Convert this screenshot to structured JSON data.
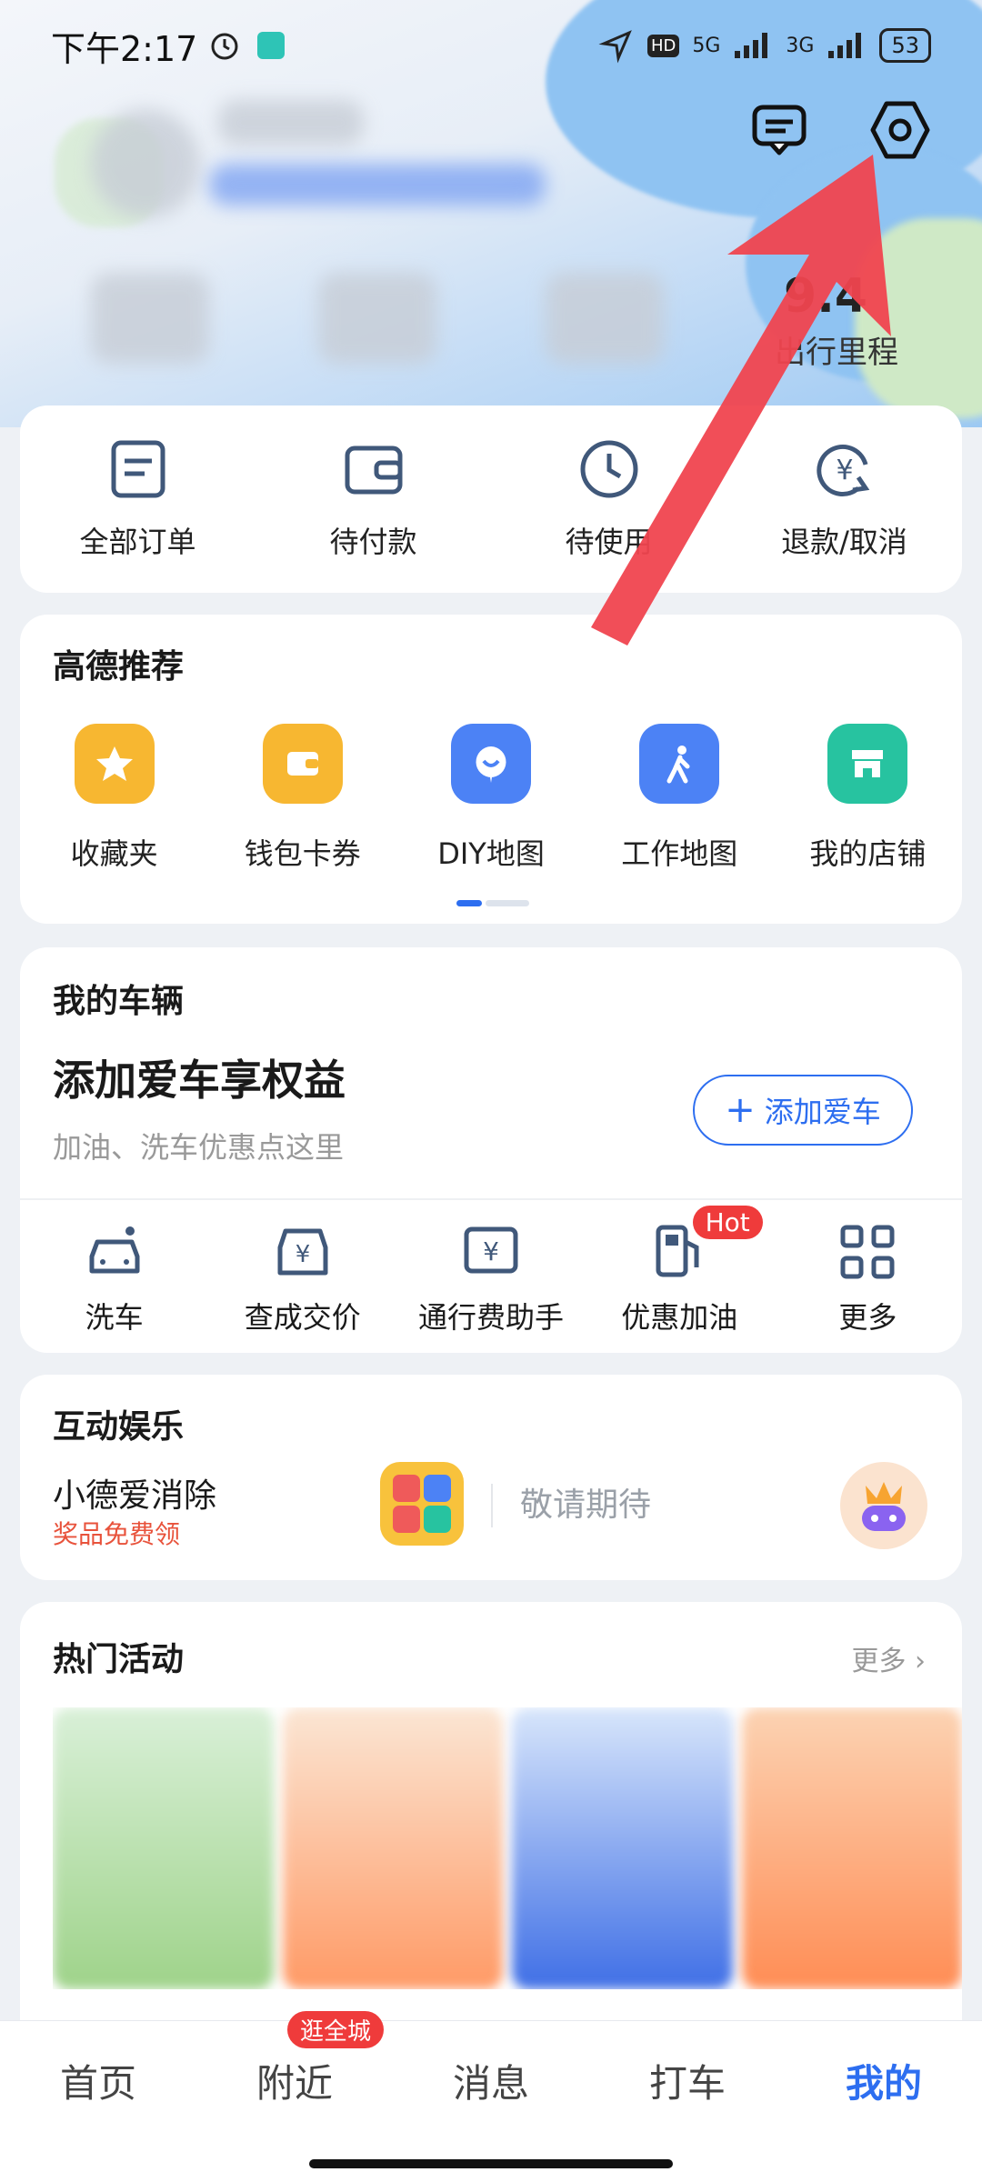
{
  "status": {
    "time": "下午2:17",
    "network1": "5G",
    "network2": "3G",
    "hd": "HD",
    "battery": "53"
  },
  "header": {
    "mileage_value": "9.4",
    "mileage_label": "出行里程"
  },
  "quick_actions": [
    {
      "label": "全部订单",
      "icon": "order-list-icon"
    },
    {
      "label": "待付款",
      "icon": "wallet-icon"
    },
    {
      "label": "待使用",
      "icon": "clock-icon"
    },
    {
      "label": "退款/取消",
      "icon": "refund-icon"
    }
  ],
  "recommend": {
    "title": "高德推荐",
    "items": [
      {
        "label": "收藏夹",
        "icon": "star-icon",
        "color": "#f7b731"
      },
      {
        "label": "钱包卡券",
        "icon": "wallet-card-icon",
        "color": "#f7b731"
      },
      {
        "label": "DIY地图",
        "icon": "diy-map-icon",
        "color": "#4c82f5"
      },
      {
        "label": "工作地图",
        "icon": "walker-icon",
        "color": "#4c82f5"
      },
      {
        "label": "我的店铺",
        "icon": "shop-icon",
        "color": "#27c3a0"
      }
    ]
  },
  "vehicle": {
    "title": "我的车辆",
    "headline": "添加爱车享权益",
    "subtitle": "加油、洗车优惠点这里",
    "add_button": "添加爱车",
    "items": [
      {
        "label": "洗车",
        "icon": "car-wash-icon"
      },
      {
        "label": "查成交价",
        "icon": "car-price-icon"
      },
      {
        "label": "通行费助手",
        "icon": "toll-icon"
      },
      {
        "label": "优惠加油",
        "icon": "fuel-icon",
        "badge": "Hot"
      },
      {
        "label": "更多",
        "icon": "grid-more-icon"
      }
    ]
  },
  "entertainment": {
    "title": "互动娱乐",
    "game_title": "小德爱消除",
    "game_sub": "奖品免费领",
    "coming": "敬请期待"
  },
  "activities": {
    "title": "热门活动",
    "more": "更多"
  },
  "tabbar": {
    "tabs": [
      {
        "label": "首页"
      },
      {
        "label": "附近",
        "badge": "逛全城"
      },
      {
        "label": "消息"
      },
      {
        "label": "打车"
      },
      {
        "label": "我的",
        "active": true
      }
    ]
  },
  "colors": {
    "accent": "#2d6ef0",
    "hot": "#ef3b3b",
    "arrow": "#f0454f"
  }
}
